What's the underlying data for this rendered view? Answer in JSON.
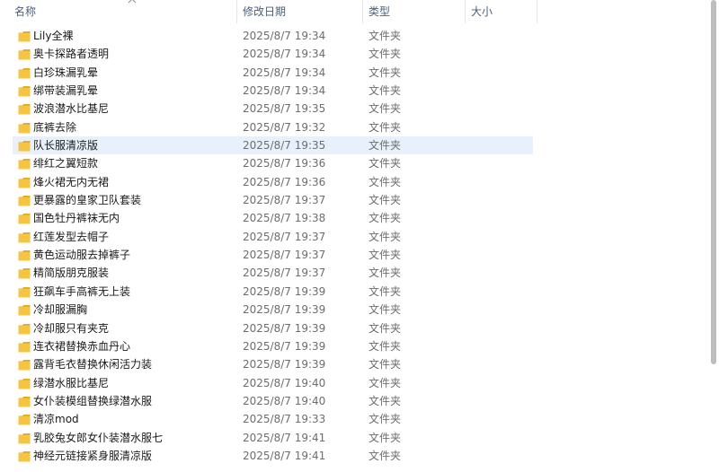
{
  "columns": {
    "name": "名称",
    "date": "修改日期",
    "type": "类型",
    "size": "大小"
  },
  "files": [
    {
      "name": "Lily全裸",
      "date": "2025/8/7 19:34",
      "type": "文件夹"
    },
    {
      "name": "奥卡探路者透明",
      "date": "2025/8/7 19:34",
      "type": "文件夹"
    },
    {
      "name": "白珍珠漏乳晕",
      "date": "2025/8/7 19:34",
      "type": "文件夹"
    },
    {
      "name": "绑带装漏乳晕",
      "date": "2025/8/7 19:34",
      "type": "文件夹"
    },
    {
      "name": "波浪潜水比基尼",
      "date": "2025/8/7 19:35",
      "type": "文件夹"
    },
    {
      "name": "底裤去除",
      "date": "2025/8/7 19:32",
      "type": "文件夹"
    },
    {
      "name": "队长服清凉版",
      "date": "2025/8/7 19:35",
      "type": "文件夹"
    },
    {
      "name": "绯红之翼短款",
      "date": "2025/8/7 19:36",
      "type": "文件夹"
    },
    {
      "name": "烽火裙无内无裙",
      "date": "2025/8/7 19:36",
      "type": "文件夹"
    },
    {
      "name": "更暴露的皇家卫队套装",
      "date": "2025/8/7 19:37",
      "type": "文件夹"
    },
    {
      "name": "国色牡丹裤袜无内",
      "date": "2025/8/7 19:38",
      "type": "文件夹"
    },
    {
      "name": "红莲发型去帽子",
      "date": "2025/8/7 19:37",
      "type": "文件夹"
    },
    {
      "name": "黄色运动服去掉裤子",
      "date": "2025/8/7 19:37",
      "type": "文件夹"
    },
    {
      "name": "精简版朋克服装",
      "date": "2025/8/7 19:37",
      "type": "文件夹"
    },
    {
      "name": "狂飙车手高裤无上装",
      "date": "2025/8/7 19:39",
      "type": "文件夹"
    },
    {
      "name": "冷却服漏胸",
      "date": "2025/8/7 19:39",
      "type": "文件夹"
    },
    {
      "name": "冷却服只有夹克",
      "date": "2025/8/7 19:39",
      "type": "文件夹"
    },
    {
      "name": "连衣裙替换赤血丹心",
      "date": "2025/8/7 19:39",
      "type": "文件夹"
    },
    {
      "name": "露背毛衣替换休闲活力装",
      "date": "2025/8/7 19:39",
      "type": "文件夹"
    },
    {
      "name": "绿潜水服比基尼",
      "date": "2025/8/7 19:40",
      "type": "文件夹"
    },
    {
      "name": "女仆装模组替换绿潜水服",
      "date": "2025/8/7 19:40",
      "type": "文件夹"
    },
    {
      "name": "清凉mod",
      "date": "2025/8/7 19:33",
      "type": "文件夹"
    },
    {
      "name": "乳胶兔女郎女仆装潜水服七",
      "date": "2025/8/7 19:41",
      "type": "文件夹"
    },
    {
      "name": "神经元链接紧身服清凉版",
      "date": "2025/8/7 19:41",
      "type": "文件夹"
    }
  ],
  "selected_index": 6,
  "colors": {
    "folder": "#f5c542",
    "selection": "#e8f1fb",
    "header_text": "#4c607a"
  }
}
